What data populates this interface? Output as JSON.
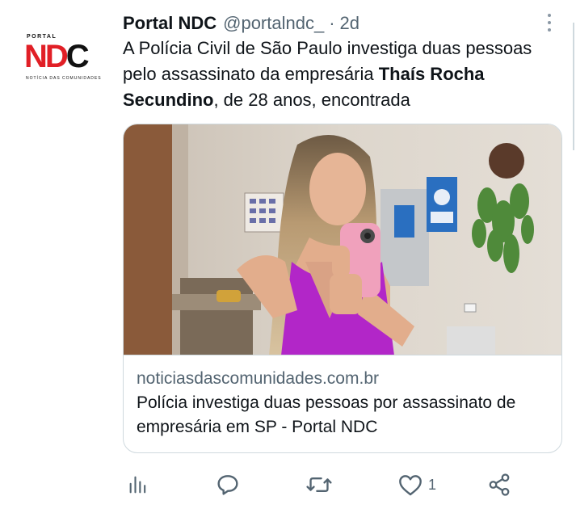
{
  "tweet": {
    "avatar": {
      "top_text": "PORTAL",
      "letters": [
        "N",
        "D",
        "C"
      ],
      "bottom_text": "NOTÍCIA DAS COMUNIDADES"
    },
    "display_name": "Portal NDC",
    "handle": "@portalndc_",
    "separator": "·",
    "time": "2d",
    "text": {
      "part1": "A Polícia Civil de São Paulo investiga duas pessoas pelo assassinato da empresária ",
      "bold": "Thaís Rocha Secundino",
      "part2": ", de 28 anos, encontrada"
    },
    "card": {
      "domain": "noticiasdascomunidades.com.br",
      "title": "Polícia investiga duas pessoas por assassinato de empresária em SP - Portal NDC"
    },
    "actions": {
      "like_count": "1"
    }
  },
  "colors": {
    "text": "#0f1419",
    "secondary": "#536471",
    "border": "#cfd9de",
    "brand_red": "#e11f26",
    "icon": "#536471"
  }
}
